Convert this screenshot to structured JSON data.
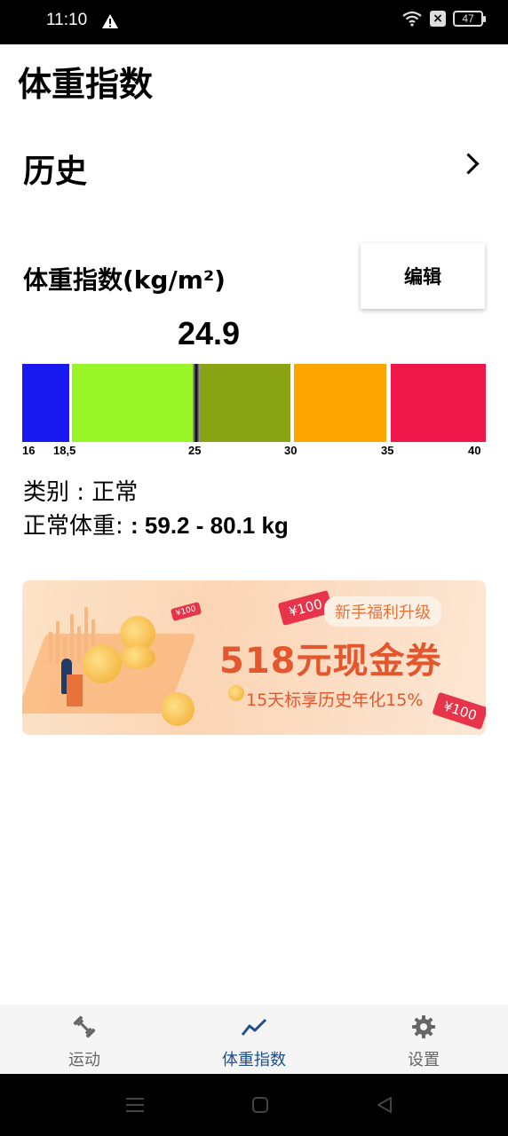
{
  "status": {
    "time": "11:10",
    "battery": "47"
  },
  "page": {
    "title": "体重指数"
  },
  "history": {
    "label": "历史"
  },
  "bmi": {
    "label": "体重指数(kg/m²)",
    "edit_label": "编辑",
    "value": "24.9",
    "scale_ticks": [
      "16",
      "18,5",
      "25",
      "30",
      "35",
      "40"
    ],
    "segment_colors": [
      "#1919f2",
      "#99f527",
      "#8aa313",
      "#ffa500",
      "#f0174a"
    ],
    "category_line": "类别 : 正常",
    "normal_weight_label": "正常体重: ",
    "normal_weight_value": ": 59.2 - 80.1 kg"
  },
  "banner": {
    "tag": "新手福利升级",
    "title": "518元现金券",
    "subtitle": "15天标享历史年化15%",
    "coupon_1": "¥100",
    "coupon_2": "¥100",
    "coupon_small": "¥100"
  },
  "nav": {
    "items": [
      {
        "label": "运动",
        "icon": "dumbbell-icon",
        "color": "#666666"
      },
      {
        "label": "体重指数",
        "icon": "trend-line-icon",
        "color": "#1f4e8c"
      },
      {
        "label": "设置",
        "icon": "gear-icon",
        "color": "#666666"
      }
    ]
  }
}
